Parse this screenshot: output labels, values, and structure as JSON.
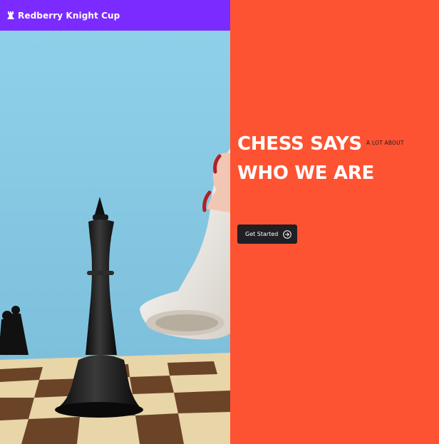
{
  "header": {
    "brand_name": "Redberry Knight Cup",
    "brand_icon": "chess-rook-icon"
  },
  "hero": {
    "image": "chess-pieces-photo",
    "background_color": "#8dcde6"
  },
  "main": {
    "headline_line1": "CHESS SAYS",
    "headline_line2": "WHO WE ARE",
    "tagline": "A LOT ABOUT",
    "cta_label": "Get Started",
    "cta_icon": "arrow-right-circle-icon"
  },
  "colors": {
    "brand_purple": "#7b2bff",
    "accent_orange": "#fe5332",
    "button_dark": "#1f1f24"
  }
}
